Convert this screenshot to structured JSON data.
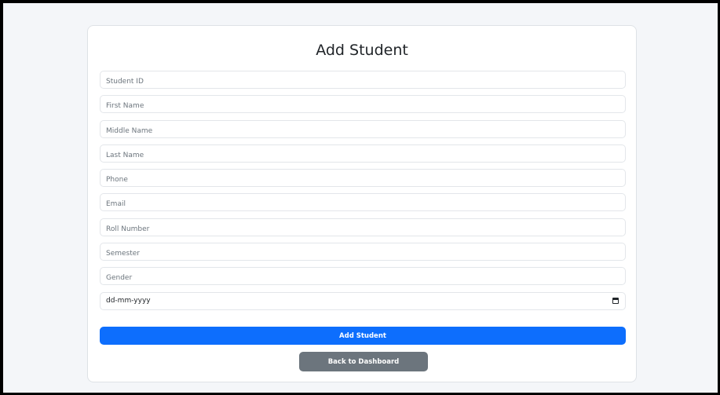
{
  "form": {
    "title": "Add Student",
    "fields": [
      {
        "placeholder": "Student ID"
      },
      {
        "placeholder": "First Name"
      },
      {
        "placeholder": "Middle Name"
      },
      {
        "placeholder": "Last Name"
      },
      {
        "placeholder": "Phone"
      },
      {
        "placeholder": "Email"
      },
      {
        "placeholder": "Roll Number"
      },
      {
        "placeholder": "Semester"
      },
      {
        "placeholder": "Gender"
      }
    ],
    "date_placeholder": "dd-mm-yyyy",
    "submit_label": "Add Student",
    "back_label": "Back to Dashboard"
  },
  "colors": {
    "page_bg": "#f4f6f9",
    "primary": "#0d6efd",
    "secondary": "#6c757d"
  }
}
